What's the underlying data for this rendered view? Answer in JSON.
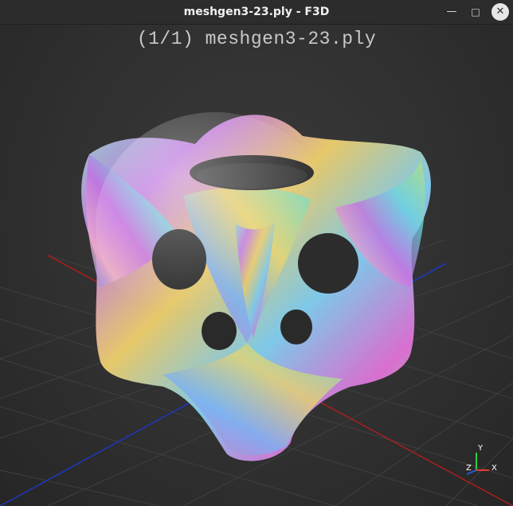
{
  "window": {
    "title": "meshgen3-23.ply - F3D",
    "controls": {
      "minimize_icon": "minimize-icon",
      "maximize_icon": "maximize-icon",
      "close_icon": "close-icon"
    }
  },
  "viewport": {
    "filename_label": "(1/1) meshgen3-23.ply",
    "background_color": "#333333",
    "grid_color": "#3f3f3f",
    "x_axis_color": "#c01d1d",
    "z_axis_color": "#1d3fc0"
  },
  "axes_widget": {
    "y_label": "Y",
    "z_label": "Z",
    "x_label": "X",
    "y_color": "#2ecc40",
    "x_color": "#e53935",
    "z_color": "#2b58d9"
  }
}
